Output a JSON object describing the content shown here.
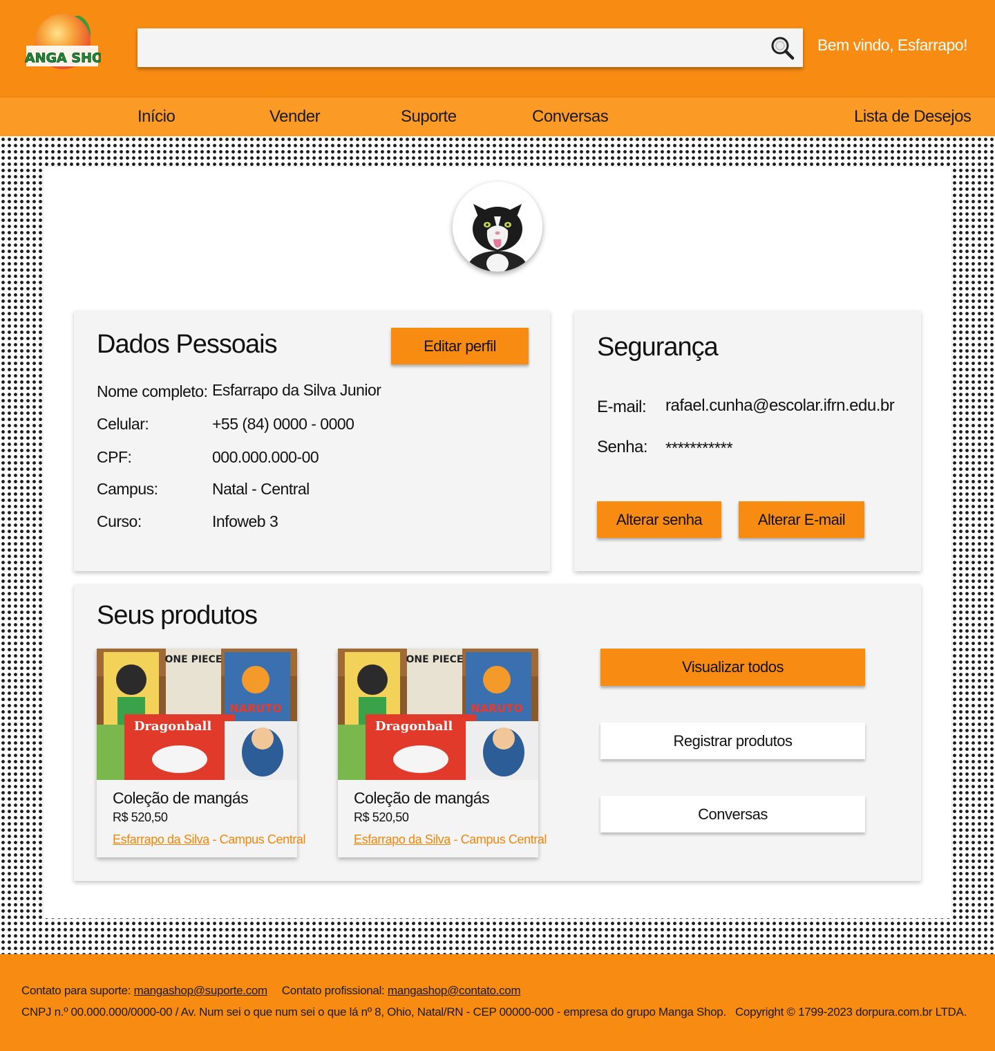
{
  "header": {
    "logo_text": "MANGA SHOP",
    "search_value": "",
    "welcome": "Bem vindo, Esfarrapo!"
  },
  "nav": {
    "inicio": "Início",
    "vender": "Vender",
    "suporte": "Suporte",
    "conversas": "Conversas",
    "lista_desejos": "Lista de Desejos"
  },
  "dados": {
    "title": "Dados Pessoais",
    "edit_button": "Editar perfil",
    "rows": [
      {
        "label": "Nome completo:",
        "value": "Esfarrapo da Silva Junior"
      },
      {
        "label": "Celular:",
        "value": "+55 (84) 0000 - 0000"
      },
      {
        "label": "CPF:",
        "value": "000.000.000-00"
      },
      {
        "label": "Campus:",
        "value": "Natal - Central"
      },
      {
        "label": "Curso:",
        "value": "Infoweb 3"
      }
    ]
  },
  "seguranca": {
    "title": "Segurança",
    "email_label": "E-mail:",
    "email_value": "rafael.cunha@escolar.ifrn.edu.br",
    "senha_label": "Senha:",
    "senha_value": "***********",
    "alterar_senha": "Alterar senha",
    "alterar_email": "Alterar E-mail"
  },
  "produtos": {
    "title": "Seus produtos",
    "items": [
      {
        "title": "Coleção de mangás",
        "price": "R$ 520,50",
        "seller": "Esfarrapo da Silva",
        "campus": " - Campus Central"
      },
      {
        "title": "Coleção de mangás",
        "price": "R$ 520,50",
        "seller": "Esfarrapo da Silva",
        "campus": " - Campus Central"
      }
    ],
    "visualizar_todos": "Visualizar todos",
    "registrar": "Registrar produtos",
    "conversas": "Conversas"
  },
  "footer": {
    "suporte_label": "Contato para suporte:",
    "suporte_email": "mangashop@suporte.com",
    "profissional_label": "Contato profissional:",
    "profissional_email": "mangashop@contato.com",
    "address": "CNPJ n.º 00.000.000/0000-00 / Av. Num sei o que num sei o que lá nº 8, Ohio, Natal/RN - CEP 00000-000 - empresa do grupo Manga Shop.",
    "copyright": "Copyright © 1799-2023 dorpura.com.br LTDA."
  },
  "colors": {
    "brand_orange": "#f88c12",
    "nav_orange": "#fb9b26",
    "card_bg": "#f4f4f4"
  }
}
